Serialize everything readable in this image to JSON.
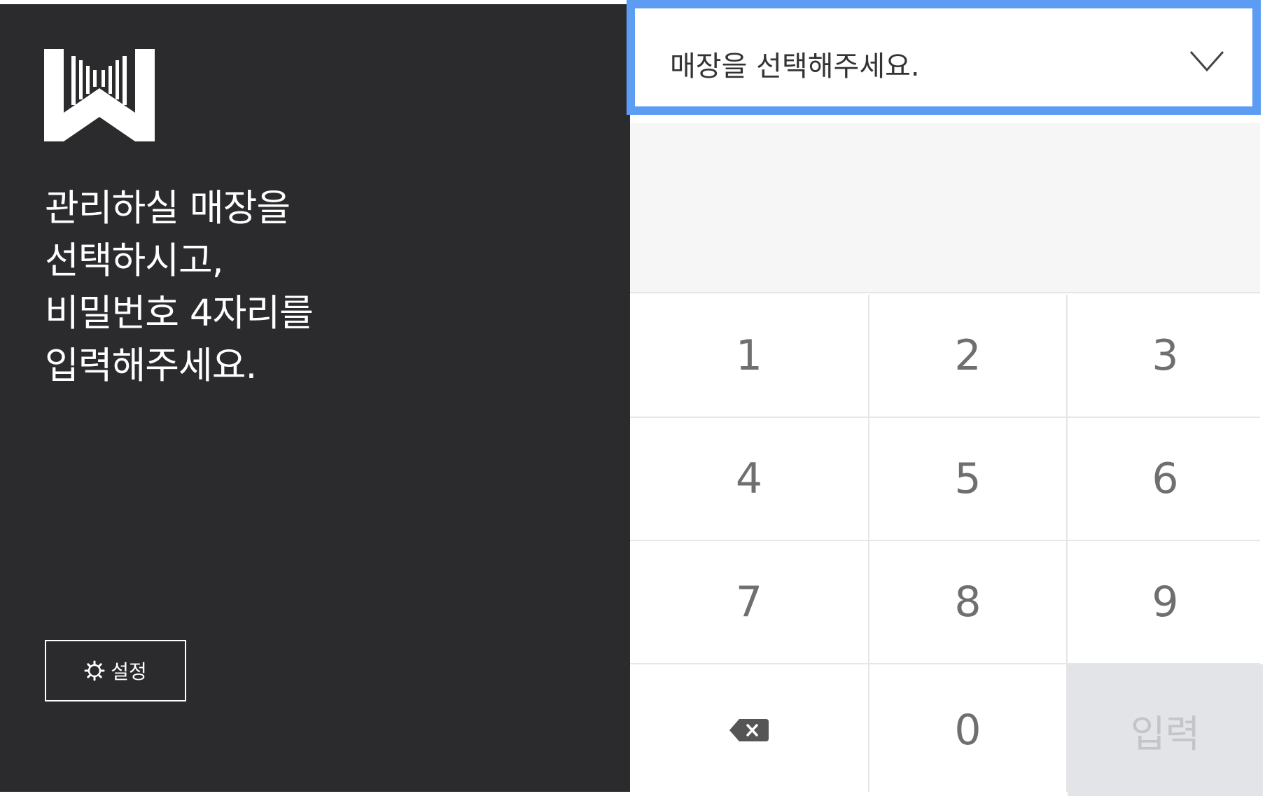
{
  "left_panel": {
    "logo_icon": "w-barcode-logo",
    "headline": [
      "관리하실 매장을",
      "선택하시고,",
      "비밀번호 4자리를",
      "입력해주세요."
    ],
    "settings": {
      "icon": "gear-icon",
      "label": "설정"
    }
  },
  "store_select": {
    "placeholder": "매장을 선택해주세요.",
    "icon": "chevron-down-icon",
    "focus_color": "#5c9cf3"
  },
  "pin": {
    "value": ""
  },
  "keypad": {
    "keys": [
      "1",
      "2",
      "3",
      "4",
      "5",
      "6",
      "7",
      "8",
      "9"
    ],
    "backspace_icon": "backspace-icon",
    "zero": "0",
    "enter_label": "입력"
  },
  "colors": {
    "left_background": "#2b2b2d",
    "accent": "#5c9cf3",
    "key_text": "#6f6f6f",
    "enter_disabled_bg": "#e2e4e7"
  }
}
